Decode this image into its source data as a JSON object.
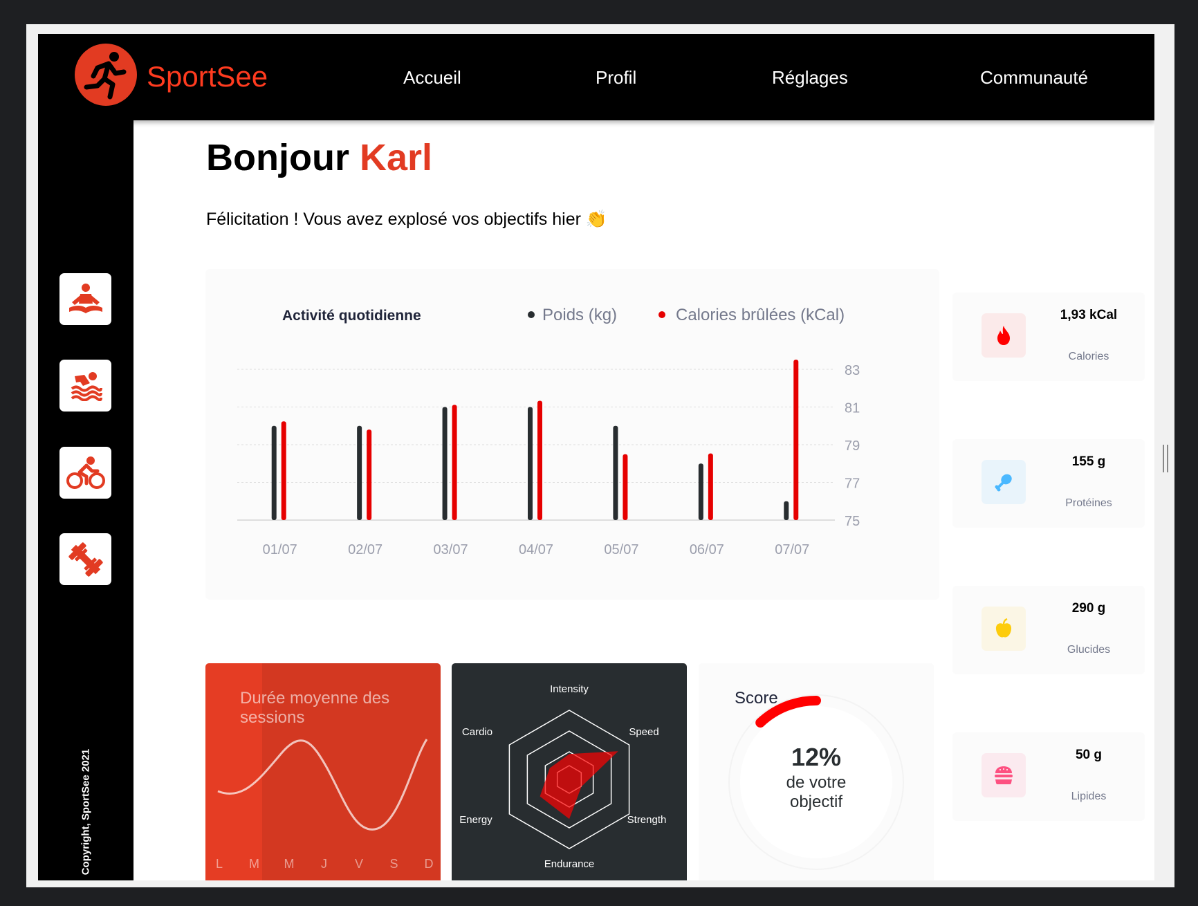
{
  "brand": {
    "name": "SportSee"
  },
  "nav": [
    {
      "label": "Accueil"
    },
    {
      "label": "Profil"
    },
    {
      "label": "Réglages"
    },
    {
      "label": "Communauté"
    }
  ],
  "sidebar": {
    "icons": [
      "meditation-icon",
      "swimming-icon",
      "cycling-icon",
      "dumbbell-icon"
    ],
    "copyright": "Copyright, SportSee 2021"
  },
  "greeting": {
    "hello": "Bonjour",
    "name": "Karl"
  },
  "congrats": "Félicitation ! Vous avez explosé vos objectifs hier 👏",
  "activity": {
    "title": "Activité quotidienne",
    "legend_weight": "Poids (kg)",
    "legend_calories": "Calories brûlées (kCal)"
  },
  "sessions": {
    "title": "Durée moyenne des sessions",
    "days": [
      "L",
      "M",
      "M",
      "J",
      "V",
      "S",
      "D"
    ]
  },
  "radar": {
    "labels": [
      "Intensity",
      "Speed",
      "Strength",
      "Endurance",
      "Energy",
      "Cardio"
    ]
  },
  "score": {
    "title": "Score",
    "value": "12%",
    "line1": "de votre",
    "line2": "objectif"
  },
  "key_data": [
    {
      "value": "1,93 kCal",
      "label": "Calories",
      "icon": "flame-icon",
      "bg": "#fbeaea",
      "color": "#ff0000"
    },
    {
      "value": "155 g",
      "label": "Protéines",
      "icon": "chicken-icon",
      "bg": "#e9f4fb",
      "color": "#4ab8ff"
    },
    {
      "value": "290 g",
      "label": "Glucides",
      "icon": "apple-icon",
      "bg": "#fbf6e5",
      "color": "#fdcc0c"
    },
    {
      "value": "50 g",
      "label": "Lipides",
      "icon": "burger-icon",
      "bg": "#fbeaef",
      "color": "#fd5181"
    }
  ],
  "colors": {
    "accent": "#e60000",
    "dark": "#282d30",
    "sessions_bg": "#ff0000",
    "text_muted": "#74798c"
  },
  "chart_data": [
    {
      "type": "bar",
      "title": "Activité quotidienne",
      "categories": [
        "01/07",
        "02/07",
        "03/07",
        "04/07",
        "05/07",
        "06/07",
        "07/07"
      ],
      "series": [
        {
          "name": "Poids (kg)",
          "values": [
            80,
            80,
            81,
            81,
            80,
            78,
            76
          ]
        },
        {
          "name": "Calories brûlées (kCal)",
          "values": [
            240,
            220,
            280,
            290,
            160,
            162,
            390
          ]
        }
      ],
      "y_ticks": [
        75,
        77,
        79,
        81,
        83
      ],
      "ylim": [
        75,
        83
      ],
      "legend": "top-right",
      "grid": true
    },
    {
      "type": "line",
      "title": "Durée moyenne des sessions",
      "categories": [
        "L",
        "M",
        "M",
        "J",
        "V",
        "S",
        "D"
      ],
      "values": [
        30,
        23,
        45,
        50,
        0,
        0,
        60
      ]
    },
    {
      "type": "radar",
      "categories": [
        "Intensity",
        "Speed",
        "Strength",
        "Endurance",
        "Energy",
        "Cardio"
      ],
      "values": [
        90,
        200,
        50,
        140,
        120,
        80
      ],
      "max": 250
    },
    {
      "type": "pie",
      "title": "Score",
      "values": [
        0.12
      ]
    }
  ]
}
